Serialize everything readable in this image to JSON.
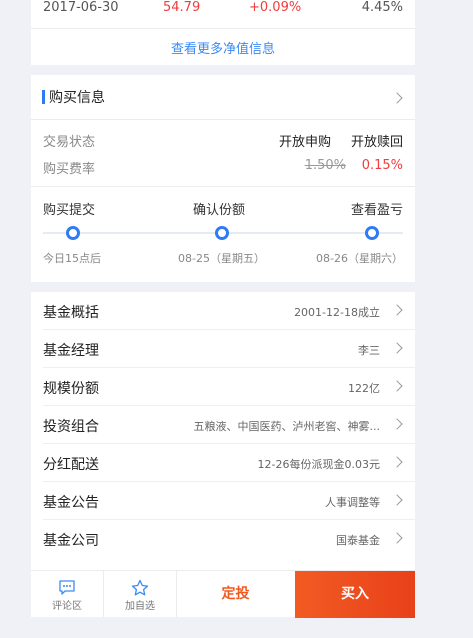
{
  "net_value_row": {
    "date": "2017-06-30",
    "value": "54.79",
    "change": "+0.09%",
    "rate": "4.45%"
  },
  "more_link": "查看更多净值信息",
  "purchase": {
    "title": "购买信息",
    "trade_status_label": "交易状态",
    "trade_status_open_buy": "开放申购",
    "trade_status_open_redeem": "开放赎回",
    "fee_label": "购买费率",
    "fee_original": "1.50%",
    "fee_discount": "0.15%",
    "steps": [
      {
        "label": "购买提交",
        "sub": "今日15点后"
      },
      {
        "label": "确认份额",
        "sub": "08-25（星期五）"
      },
      {
        "label": "查看盈亏",
        "sub": "08-26（星期六）"
      }
    ]
  },
  "info_list": [
    {
      "label": "基金概括",
      "value": "2001-12-18成立"
    },
    {
      "label": "基金经理",
      "value": "李三"
    },
    {
      "label": "规模份额",
      "value": "122亿"
    },
    {
      "label": "投资组合",
      "value": "五粮液、中国医药、泸州老窖、神雾..."
    },
    {
      "label": "分红配送",
      "value": "12-26每份派现金0.03元"
    },
    {
      "label": "基金公告",
      "value": "人事调整等"
    },
    {
      "label": "基金公司",
      "value": "国泰基金"
    }
  ],
  "bottom_bar": {
    "comment": "评论区",
    "watchlist": "加自选",
    "dingtou": "定投",
    "buy": "买入"
  },
  "colors": {
    "accent_blue": "#2f7bf5",
    "red": "#f03c3c",
    "buy_orange": "#f25b23"
  }
}
